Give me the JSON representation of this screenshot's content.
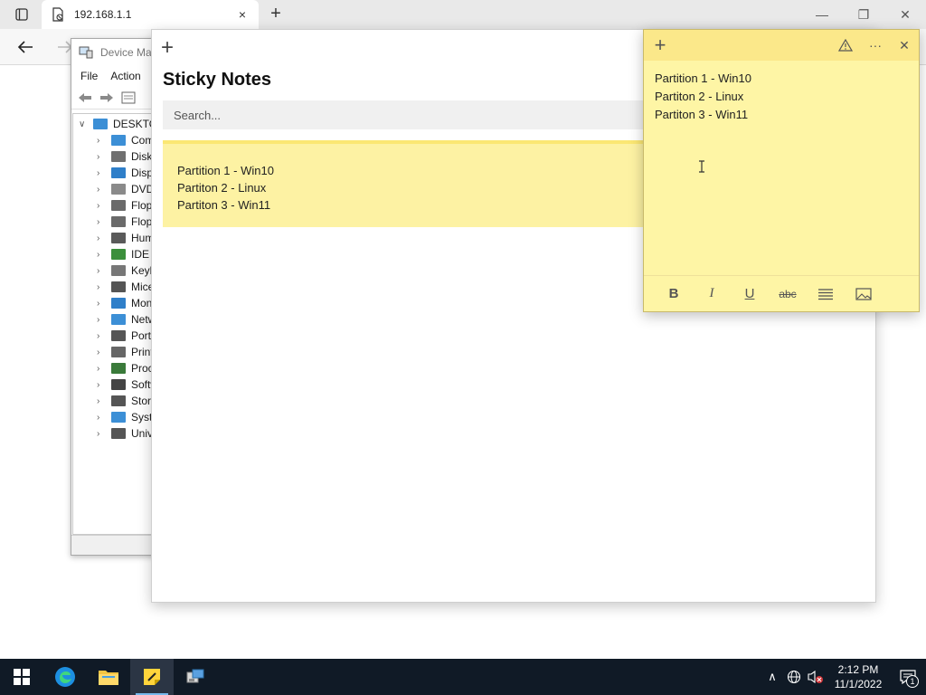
{
  "browser": {
    "tab_title": "192.168.1.1",
    "tab_close": "×",
    "new_tab": "+",
    "minimize": "—",
    "restore": "❐",
    "close": "✕"
  },
  "device_manager": {
    "title": "Device Mar",
    "menu": [
      "File",
      "Action"
    ],
    "root": "DESKTOP",
    "items": [
      {
        "label": "Com",
        "color": "#3c8fd6"
      },
      {
        "label": "Disk",
        "color": "#707070"
      },
      {
        "label": "Displ",
        "color": "#2f7fc9"
      },
      {
        "label": "DVD/",
        "color": "#8a8a8a"
      },
      {
        "label": "Flopp",
        "color": "#6a6a6a"
      },
      {
        "label": "Flopp",
        "color": "#6a6a6a"
      },
      {
        "label": "Hum",
        "color": "#5a5a5a"
      },
      {
        "label": "IDE A",
        "color": "#3b8f3b"
      },
      {
        "label": "Keyb",
        "color": "#777777"
      },
      {
        "label": "Mice",
        "color": "#555555"
      },
      {
        "label": "Mon",
        "color": "#2f7fc9"
      },
      {
        "label": "Netw",
        "color": "#3c8fd6"
      },
      {
        "label": "Ports",
        "color": "#555555"
      },
      {
        "label": "Print",
        "color": "#666666"
      },
      {
        "label": "Proc",
        "color": "#3a7a3a"
      },
      {
        "label": "Softw",
        "color": "#444444"
      },
      {
        "label": "Stora",
        "color": "#555555"
      },
      {
        "label": "Syste",
        "color": "#3c8fd6"
      },
      {
        "label": "Univ",
        "color": "#555555"
      }
    ]
  },
  "sticky_list": {
    "add_button": "+",
    "title": "Sticky Notes",
    "search_placeholder": "Search...",
    "note_lines": [
      "Partition 1 - Win10",
      "Partiton 2 - Linux",
      "Partiton 3 - Win11"
    ]
  },
  "sticky_note": {
    "add_button": "+",
    "more_button": "···",
    "close_button": "✕",
    "lines": [
      "Partition 1 - Win10",
      "Partiton 2 - Linux",
      "Partiton 3 - Win11"
    ],
    "format": {
      "bold": "B",
      "italic": "I",
      "underline": "U",
      "strike": "abc"
    },
    "colors": {
      "body": "#fef5a5",
      "header": "#fbe88a"
    }
  },
  "taskbar": {
    "time": "2:12 PM",
    "date": "11/1/2022",
    "notification_count": "1",
    "tray_chevron": "∧"
  }
}
